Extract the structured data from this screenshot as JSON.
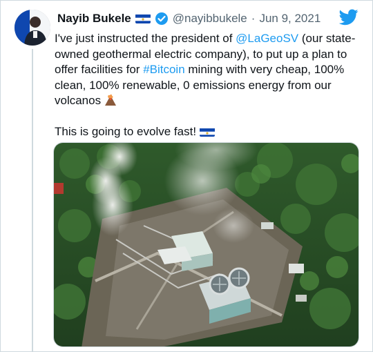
{
  "tweet": {
    "author_name": "Nayib Bukele",
    "handle": "@nayibbukele",
    "separator": "·",
    "date": "Jun 9, 2021",
    "text_part1": "I've just instructed the president of ",
    "mention": "@LaGeoSV",
    "text_part2": " (our state-owned geothermal electric company), to put up a plan to offer facilities for ",
    "hashtag": "#Bitcoin",
    "text_part3": " mining with very cheap, 100% clean, 100% renewable, 0 emissions energy from our volcanos",
    "text_line2": "This is going to evolve fast!"
  },
  "icons": {
    "brand": "twitter-bird-icon",
    "verified": "verified-badge-icon",
    "flag": "el-salvador-flag-icon",
    "volcano": "volcano-emoji-icon"
  },
  "colors": {
    "accent": "#1d9bf0",
    "text": "#0f1419",
    "muted": "#536471",
    "border": "#cfd9de",
    "flag_blue": "#0f47af"
  }
}
